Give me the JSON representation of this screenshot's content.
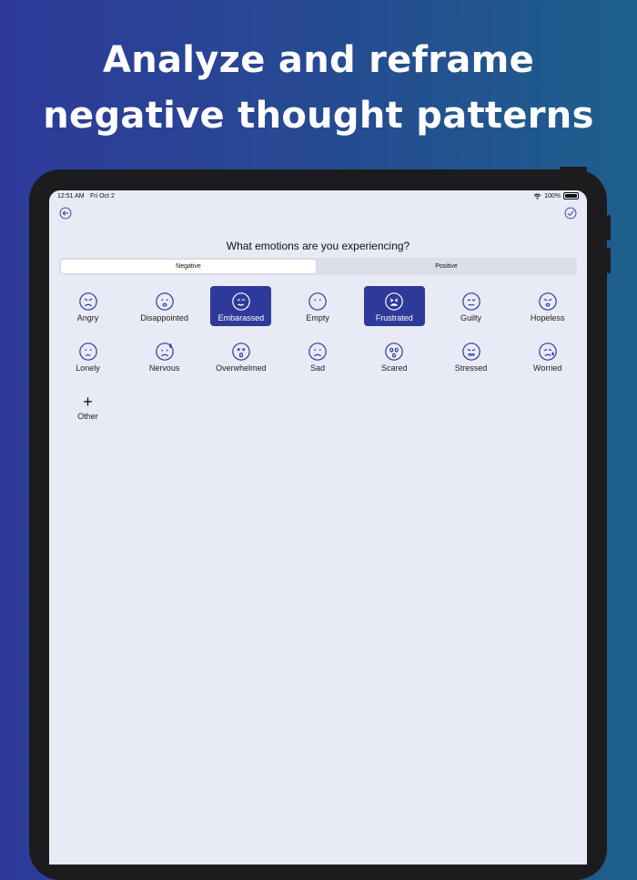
{
  "promo": {
    "line1": "Analyze and reframe",
    "line2": "negative thought patterns"
  },
  "status": {
    "time": "12:51 AM",
    "date": "Fri Oct 2",
    "battery": "100%"
  },
  "screen": {
    "question": "What emotions are you experiencing?",
    "tabs": [
      {
        "label": "Negative",
        "active": true
      },
      {
        "label": "Positive",
        "active": false
      }
    ],
    "emotions": [
      {
        "label": "Angry",
        "selected": false,
        "icon": "angry-face-icon"
      },
      {
        "label": "Disappointed",
        "selected": false,
        "icon": "disappointed-face-icon"
      },
      {
        "label": "Embarassed",
        "selected": true,
        "icon": "embarrassed-face-icon"
      },
      {
        "label": "Empty",
        "selected": false,
        "icon": "empty-face-icon"
      },
      {
        "label": "Frustrated",
        "selected": true,
        "icon": "frustrated-face-icon"
      },
      {
        "label": "Guilty",
        "selected": false,
        "icon": "guilty-face-icon"
      },
      {
        "label": "Hopeless",
        "selected": false,
        "icon": "hopeless-face-icon"
      },
      {
        "label": "Lonely",
        "selected": false,
        "icon": "lonely-face-icon"
      },
      {
        "label": "Nervous",
        "selected": false,
        "icon": "nervous-face-icon"
      },
      {
        "label": "Overwhelmed",
        "selected": false,
        "icon": "overwhelmed-face-icon"
      },
      {
        "label": "Sad",
        "selected": false,
        "icon": "sad-face-icon"
      },
      {
        "label": "Scared",
        "selected": false,
        "icon": "scared-face-icon"
      },
      {
        "label": "Stressed",
        "selected": false,
        "icon": "stressed-face-icon"
      },
      {
        "label": "Worried",
        "selected": false,
        "icon": "worried-face-icon"
      }
    ],
    "other": {
      "label": "Other",
      "symbol": "+",
      "icon": "plus-icon"
    }
  },
  "colors": {
    "accent": "#2e3a9a",
    "background": "#e8eaf5",
    "icon_stroke": "#2e3a9a"
  }
}
